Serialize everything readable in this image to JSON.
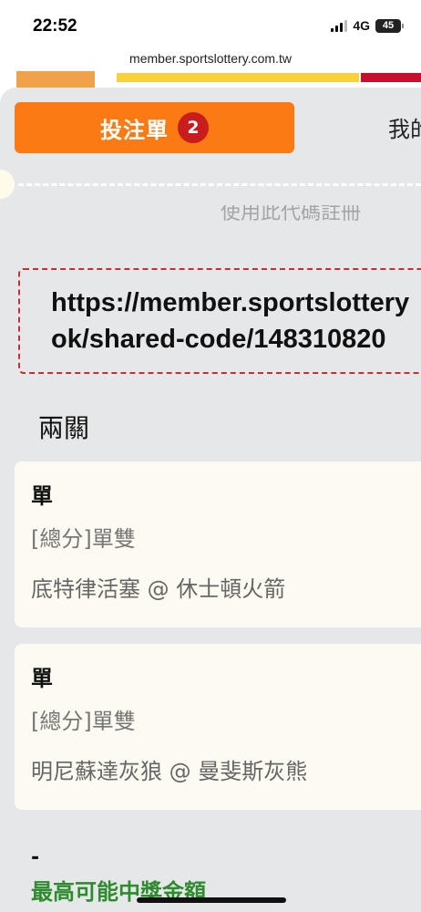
{
  "status_bar": {
    "time": "22:52",
    "network": "4G",
    "battery": "45"
  },
  "browser": {
    "url": "member.sportslottery.com.tw"
  },
  "tabs": {
    "betslip_label": "投注單",
    "betslip_count": "2",
    "my_bets_label": "我的"
  },
  "faded_text": "使用此代碼註冊",
  "share_link": {
    "line1": "https://member.sportslottery",
    "line2": "ok/shared-code/148310820"
  },
  "section_title": "兩關",
  "bets": [
    {
      "pick": "單",
      "market": "[總分]單雙",
      "match": "底特律活塞 @ 休士頓火箭"
    },
    {
      "pick": "單",
      "market": "[總分]單雙",
      "match": "明尼蘇達灰狼 @ 曼斐斯灰熊"
    }
  ],
  "dash_text": "-",
  "max_payout_label": "最高可能中獎金額",
  "colors": {
    "accent": "#fb7a14",
    "badge": "#c91d1d",
    "sheet_bg": "#e6e7e9",
    "card_bg": "#fdfbf1",
    "payout_green": "#2e8b2e",
    "link_border": "#c62f2f"
  }
}
